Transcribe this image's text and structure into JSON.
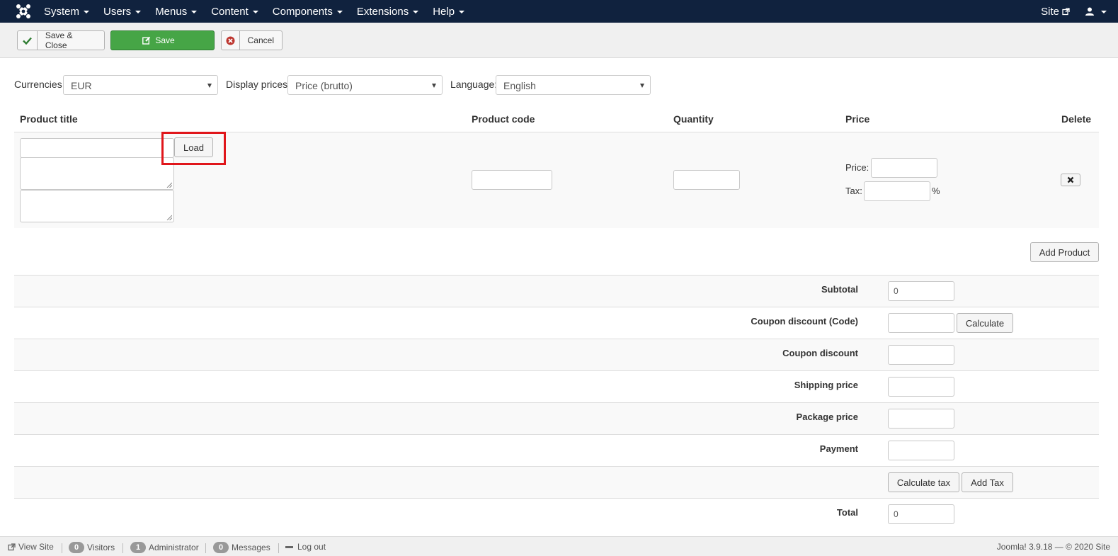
{
  "navbar": {
    "menu": [
      {
        "label": "System"
      },
      {
        "label": "Users"
      },
      {
        "label": "Menus"
      },
      {
        "label": "Content"
      },
      {
        "label": "Components"
      },
      {
        "label": "Extensions"
      },
      {
        "label": "Help"
      }
    ],
    "site_label": "Site",
    "icons": {
      "logo": "joomla-logo",
      "external": "external-link-icon",
      "user": "user-icon"
    }
  },
  "toolbar": {
    "save_close_label": "Save & Close",
    "save_label": "Save",
    "cancel_label": "Cancel"
  },
  "filters": {
    "currencies_label": "Currencies:",
    "currencies_value": "EUR",
    "display_prices_label": "Display prices:",
    "display_prices_value": "Price (brutto)",
    "language_label": "Language:",
    "language_value": "English"
  },
  "table": {
    "headers": {
      "product_title": "Product title",
      "product_code": "Product code",
      "quantity": "Quantity",
      "price": "Price",
      "delete": "Delete"
    },
    "row": {
      "load_label": "Load",
      "price_label": "Price:",
      "tax_label": "Tax:",
      "percent": "%"
    }
  },
  "add_product_label": "Add Product",
  "summary": {
    "subtotal_label": "Subtotal",
    "subtotal_value": "0",
    "coupon_code_label": "Coupon discount (Code)",
    "calculate_label": "Calculate",
    "coupon_discount_label": "Coupon discount",
    "shipping_label": "Shipping price",
    "package_label": "Package price",
    "payment_label": "Payment",
    "calculate_tax_label": "Calculate tax",
    "add_tax_label": "Add Tax",
    "total_label": "Total",
    "total_value": "0"
  },
  "footer": {
    "view_site": "View Site",
    "visitors_count": "0",
    "visitors_label": "Visitors",
    "admin_count": "1",
    "admin_label": "Administrator",
    "messages_count": "0",
    "messages_label": "Messages",
    "logout_label": "Log out",
    "copyright": "Joomla! 3.9.18  —  © 2020 Site"
  },
  "colors": {
    "navbar_bg": "#10223e",
    "save_green": "#46a546",
    "highlight_red": "#e0161b"
  }
}
